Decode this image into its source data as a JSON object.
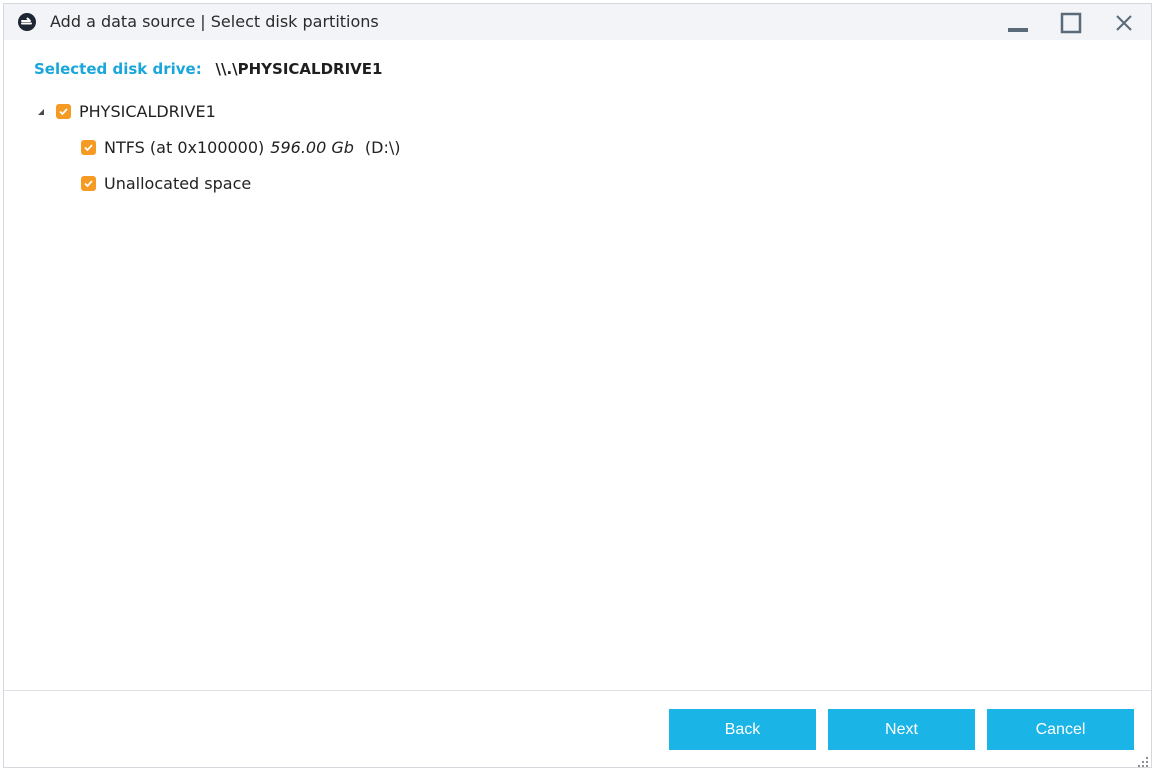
{
  "window": {
    "title": "Add a data source | Select disk partitions",
    "app_icon": "app-logo-icon"
  },
  "selected_drive": {
    "label": "Selected disk drive:",
    "value": "\\\\.\\PHYSICALDRIVE1"
  },
  "tree": {
    "root": {
      "label": "PHYSICALDRIVE1",
      "checked": true,
      "expanded": true
    },
    "partitions": [
      {
        "fs": "NTFS (at 0x100000)",
        "size": "596.00 Gb",
        "letter": "(D:\\)",
        "checked": true
      },
      {
        "label": "Unallocated space",
        "checked": true
      }
    ]
  },
  "buttons": {
    "back": "Back",
    "next": "Next",
    "cancel": "Cancel"
  },
  "colors": {
    "accent": "#1ab4e6",
    "label_blue": "#1aa6da",
    "checkbox": "#f59a23",
    "titlebar_bg": "#f2f4f7"
  }
}
